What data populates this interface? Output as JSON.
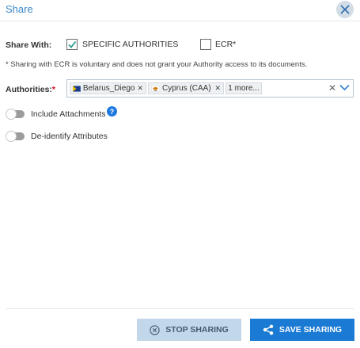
{
  "dialog": {
    "title": "Share"
  },
  "share_with": {
    "label": "Share With:",
    "options": [
      {
        "label": "SPECIFIC AUTHORITIES",
        "checked": true
      },
      {
        "label": "ECR*",
        "checked": false
      }
    ],
    "note": "* Sharing with ECR is voluntary and does not grant your Authority access to its documents."
  },
  "authorities": {
    "label": "Authorities:",
    "required_mark": "*",
    "selected": [
      {
        "label": "Belarus_Diego",
        "flag": "flag-icon"
      },
      {
        "label": "Cyprus (CAA)",
        "flag": "flag-icon"
      }
    ],
    "more": "1 more..."
  },
  "toggles": {
    "attachments": {
      "label": "Include Attachments",
      "on": false,
      "help": "?"
    },
    "deidentify": {
      "label": "De-identify Attributes",
      "on": false
    }
  },
  "footer": {
    "stop_label": "STOP SHARING",
    "save_label": "SAVE SHARING"
  },
  "colors": {
    "accent": "#1a7ad4",
    "title": "#3a87c8",
    "stop_button_bg": "#c3d7ea",
    "required": "#d0021b"
  }
}
